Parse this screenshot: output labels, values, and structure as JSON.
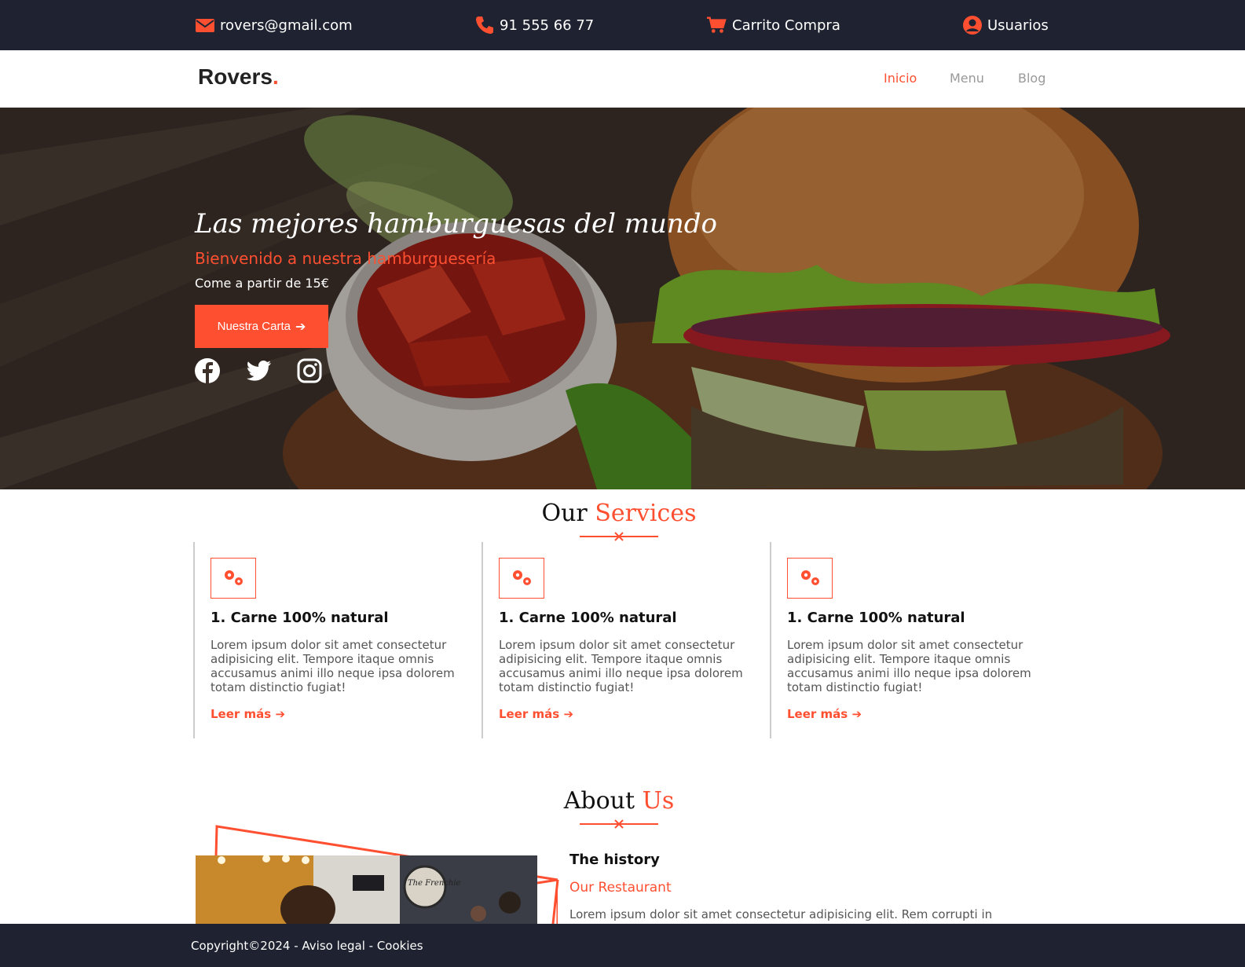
{
  "topbar": {
    "email": "rovers@gmail.com",
    "phone": "91 555 66 77",
    "cart": "Carrito Compra",
    "users": "Usuarios",
    "icon_color": "#ff4f31",
    "icons": [
      "envelope-icon",
      "phone-icon",
      "cart-icon",
      "user-circle-icon"
    ]
  },
  "nav": {
    "logo": "Rovers",
    "logo_dot": ".",
    "links": [
      "Inicio",
      "Menu",
      "Blog"
    ],
    "active": "Inicio"
  },
  "hero": {
    "title": "Las mejores hamburguesas del mundo",
    "subtitle": "Bienvenido a nuestra hamburguesería",
    "tagline": "Come a partir de 15€",
    "button": "Nuestra Carta",
    "social_icons": [
      "facebook-icon",
      "twitter-icon",
      "instagram-icon"
    ]
  },
  "services": {
    "title_a": "Our",
    "title_b": "Services",
    "cards": [
      {
        "title": "1. Carne 100% natural",
        "text": "Lorem ipsum dolor sit amet consectetur adipisicing elit. Tempore itaque omnis accusamus animi illo neque ipsa dolorem totam distinctio fugiat!",
        "more": "Leer más"
      },
      {
        "title": "1. Carne 100% natural",
        "text": "Lorem ipsum dolor sit amet consectetur adipisicing elit. Tempore itaque omnis accusamus animi illo neque ipsa dolorem totam distinctio fugiat!",
        "more": "Leer más"
      },
      {
        "title": "1. Carne 100% natural",
        "text": "Lorem ipsum dolor sit amet consectetur adipisicing elit. Tempore itaque omnis accusamus animi illo neque ipsa dolorem totam distinctio fugiat!",
        "more": "Leer más"
      }
    ]
  },
  "about": {
    "title_a": "About",
    "title_b": "Us",
    "heading": "The history",
    "subheading": "Our Restaurant",
    "text": "Lorem ipsum dolor sit amet consectetur adipisicing elit. Rem corrupti in",
    "photo_sign": "The Frenchie"
  },
  "footer": {
    "text": "Copyright©2024 - Aviso legal - Cookies"
  },
  "colors": {
    "accent": "#ff4f31",
    "dark": "#1f2230"
  }
}
